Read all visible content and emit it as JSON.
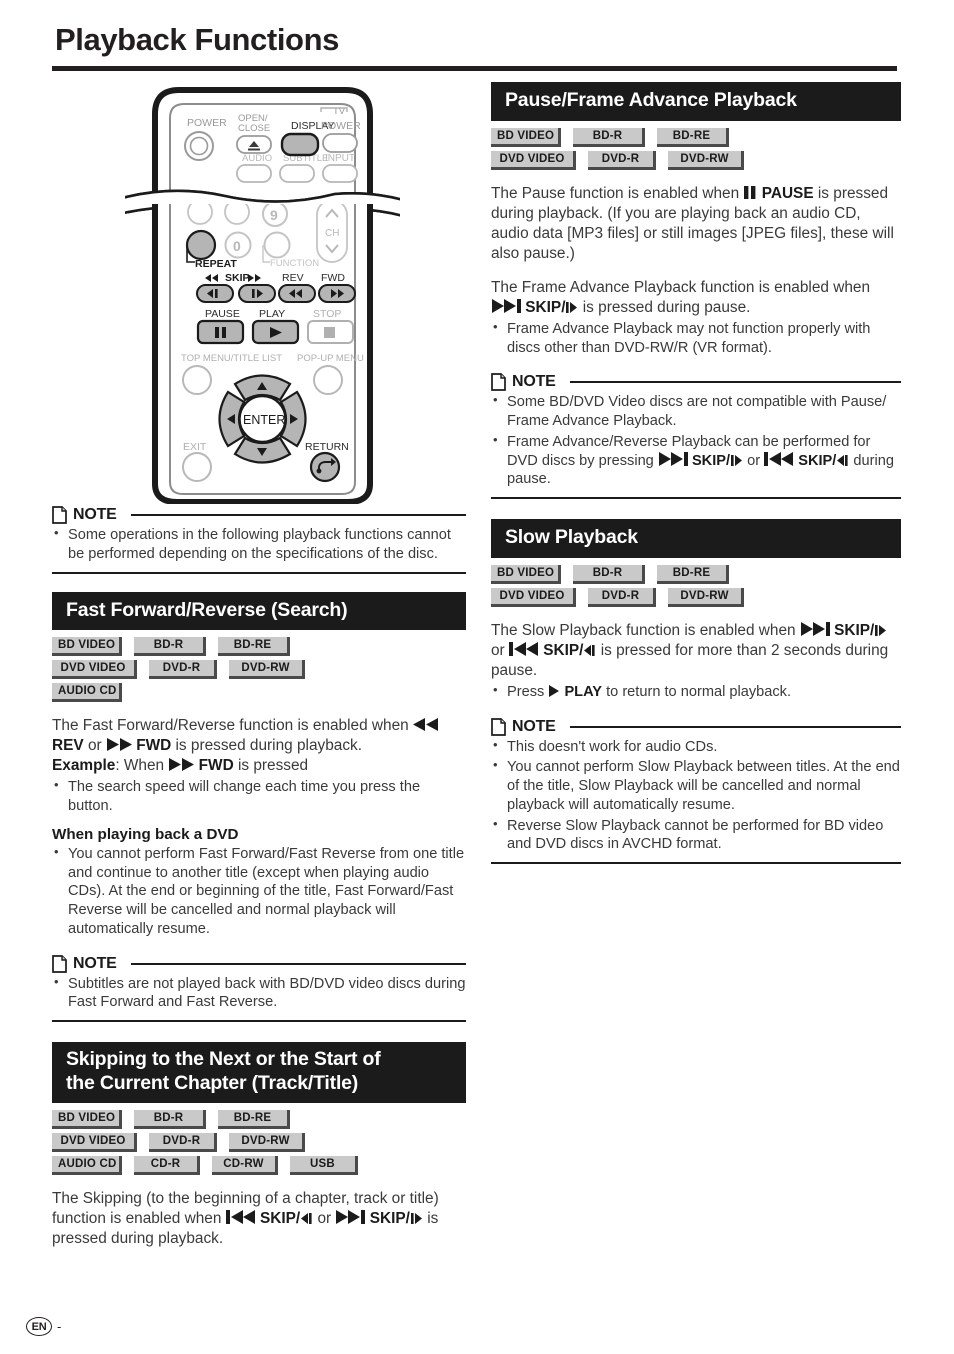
{
  "page": {
    "title": "Playback Functions",
    "footer": {
      "language_code": "EN",
      "page_number": "-"
    }
  },
  "remote": {
    "caption_labels": {
      "power": "POWER",
      "open_close": "OPEN/\nCLOSE",
      "display": "DISPLAY",
      "tv": "TV",
      "tv_power": "POWER",
      "audio": "AUDIO",
      "subtitle": "SUBTITLE",
      "input": "INPUT",
      "nine": "9",
      "zero": "0",
      "ch": "CH",
      "repeat": "REPEAT",
      "function": "FUNCTION",
      "skip": "SKIP",
      "rev": "REV",
      "fwd": "FWD",
      "pause": "PAUSE",
      "play": "PLAY",
      "stop": "STOP",
      "top_menu": "TOP MENU/TITLE LIST",
      "popup_menu": "POP-UP MENU",
      "enter": "ENTER",
      "exit": "EXIT",
      "return": "RETURN"
    }
  },
  "left_column": {
    "intro_note": {
      "label": "NOTE",
      "items": [
        "Some operations in the following playback functions cannot be performed depending on the specifications of the disc."
      ]
    },
    "fast_forward": {
      "heading": "Fast Forward/Reverse (Search)",
      "badges": [
        [
          "BD VIDEO",
          "BD-R",
          "BD-RE"
        ],
        [
          "DVD VIDEO",
          "DVD-R",
          "DVD-RW"
        ],
        [
          "AUDIO CD"
        ]
      ],
      "paragraph_1_a": "The Fast Forward/Reverse function is enabled when",
      "paragraph_1_rev": "REV",
      "paragraph_1_or": "or",
      "paragraph_1_fwd": "FWD",
      "paragraph_1_b": "is pressed during playback.",
      "example_label": "Example",
      "example_a": ": When",
      "example_fwd": "FWD",
      "example_b": "is pressed",
      "bullets": [
        "The search speed will change each time you press the button."
      ],
      "subhead": "When playing back a DVD",
      "subhead_bullets": [
        "You cannot perform Fast Forward/Fast Reverse from one title and continue to another title (except when playing audio CDs). At the end or beginning of the title, Fast Forward/Fast Reverse will be cancelled and normal playback will automatically resume."
      ],
      "note": {
        "label": "NOTE",
        "items": [
          "Subtitles are not played back with BD/DVD video discs during Fast Forward and Fast Reverse."
        ]
      }
    },
    "skipping": {
      "heading_line_1": "Skipping to the Next or the Start of",
      "heading_line_2": "the Current Chapter (Track/Title)",
      "badges": [
        [
          "BD VIDEO",
          "BD-R",
          "BD-RE"
        ],
        [
          "DVD VIDEO",
          "DVD-R",
          "DVD-RW"
        ],
        [
          "AUDIO CD",
          "CD-R",
          "CD-RW",
          "USB"
        ]
      ],
      "paragraph_a": "The Skipping (to the beginning of a chapter, track or title) function is enabled when",
      "skip_prev_label": "SKIP/",
      "paragraph_or": "or",
      "skip_next_label": "SKIP/",
      "paragraph_b": "is pressed during playback."
    }
  },
  "right_column": {
    "pause_frame": {
      "heading": "Pause/Frame Advance Playback",
      "badges": [
        [
          "BD VIDEO",
          "BD-R",
          "BD-RE"
        ],
        [
          "DVD VIDEO",
          "DVD-R",
          "DVD-RW"
        ]
      ],
      "paragraph_1_a": "The Pause function is enabled when",
      "paragraph_1_pause": "PAUSE",
      "paragraph_1_b": "is pressed during playback. (If you are playing back an audio CD, audio data [MP3 files] or still images [JPEG files], these will also pause.)",
      "paragraph_2_a": "The Frame Advance Playback function is enabled when",
      "paragraph_2_skip": "SKIP/",
      "paragraph_2_b": "is pressed during pause.",
      "bullets": [
        "Frame Advance Playback may not function properly with discs other than DVD-RW/R (VR format)."
      ],
      "note": {
        "label": "NOTE",
        "item_1": "Some BD/DVD Video discs are not compatible with Pause/ Frame Advance Playback.",
        "item_2_a": "Frame Advance/Reverse Playback can be performed for DVD discs by pressing",
        "item_2_skip_next": "SKIP/",
        "item_2_or": "or",
        "item_2_skip_prev": "SKIP/",
        "item_2_b": "during pause."
      }
    },
    "slow_playback": {
      "heading": "Slow Playback",
      "badges": [
        [
          "BD VIDEO",
          "BD-R",
          "BD-RE"
        ],
        [
          "DVD VIDEO",
          "DVD-R",
          "DVD-RW"
        ]
      ],
      "paragraph_a": "The Slow Playback function is enabled when",
      "skip_next_label": "SKIP/",
      "paragraph_or": "or",
      "skip_prev_label": "SKIP/",
      "paragraph_b": "is pressed for more than 2 seconds during pause.",
      "bullet_press": "Press",
      "bullet_play": "PLAY",
      "bullet_rest": "to return to normal playback.",
      "note": {
        "label": "NOTE",
        "items": [
          "This doesn't work for audio CDs.",
          "You cannot perform Slow Playback between titles. At the end of the title, Slow Playback will be cancelled and normal playback will automatically resume.",
          "Reverse Slow Playback cannot be performed for BD video and DVD discs in AVCHD format."
        ]
      }
    }
  },
  "colors": {
    "ink": "#231f20",
    "bar_black": "#1b1b1b",
    "badge_gray": "#c9c9c9",
    "badge_shadow": "#4a4a4a",
    "body_gray": "#3a3a3a"
  }
}
